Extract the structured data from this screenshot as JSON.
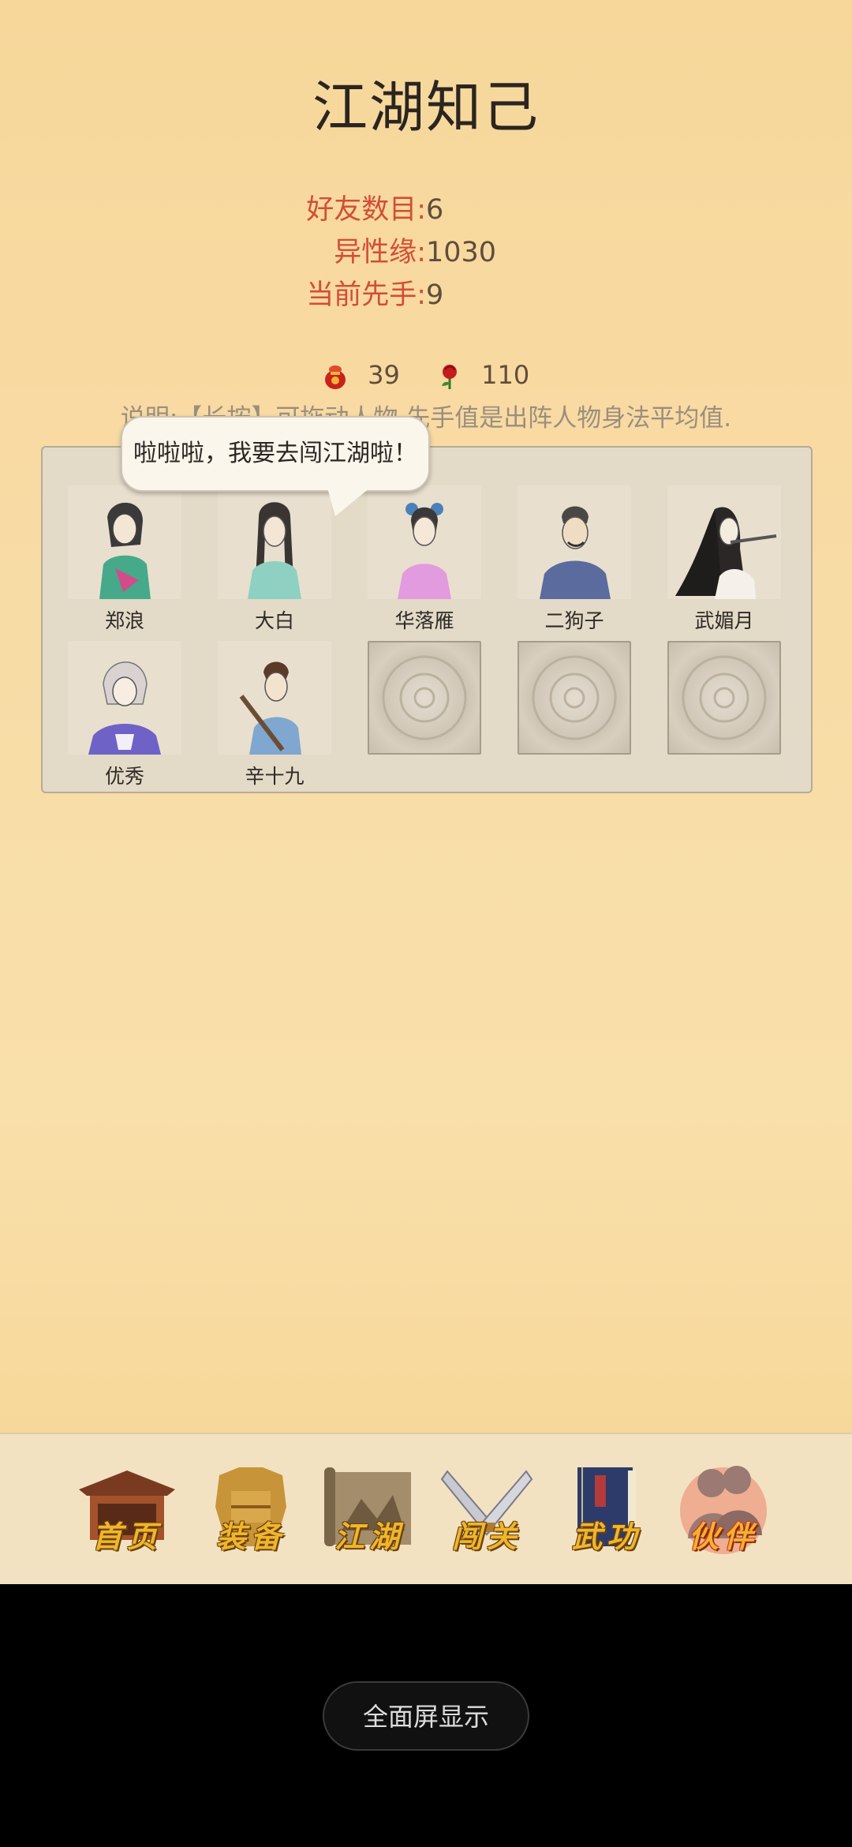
{
  "page": {
    "title": "江湖知己"
  },
  "stats": [
    {
      "label": "好友数目:",
      "value": "6"
    },
    {
      "label": "异性缘:",
      "value": "1030"
    },
    {
      "label": "当前先手:",
      "value": "9"
    }
  ],
  "resources": [
    {
      "icon": "red-pouch-icon",
      "value": "39"
    },
    {
      "icon": "rose-icon",
      "value": "110"
    }
  ],
  "note": "说明:【长按】可拖动人物,先手值是出阵人物身法平均值.",
  "speech_bubble": "啦啦啦，我要去闯江湖啦！",
  "partners": [
    {
      "name": "郑浪",
      "portrait": "zhenglang-portrait"
    },
    {
      "name": "大白",
      "portrait": "dabai-portrait"
    },
    {
      "name": "华落雁",
      "portrait": "hualuoyan-portrait"
    },
    {
      "name": "二狗子",
      "portrait": "ergouzi-portrait"
    },
    {
      "name": "武媚月",
      "portrait": "wumeiyue-portrait"
    },
    {
      "name": "优秀",
      "portrait": "youxiu-portrait"
    },
    {
      "name": "辛十九",
      "portrait": "xinshijiu-portrait"
    },
    {
      "name": "",
      "portrait": "empty-slot"
    },
    {
      "name": "",
      "portrait": "empty-slot"
    },
    {
      "name": "",
      "portrait": "empty-slot"
    }
  ],
  "nav": [
    {
      "label": "首页",
      "icon": "home-icon"
    },
    {
      "label": "装备",
      "icon": "armor-icon"
    },
    {
      "label": "江湖",
      "icon": "scroll-icon"
    },
    {
      "label": "闯关",
      "icon": "swords-icon"
    },
    {
      "label": "武功",
      "icon": "book-icon"
    },
    {
      "label": "伙伴",
      "icon": "partners-icon",
      "active": true
    }
  ],
  "fullscreen_button": "全面屏显示"
}
